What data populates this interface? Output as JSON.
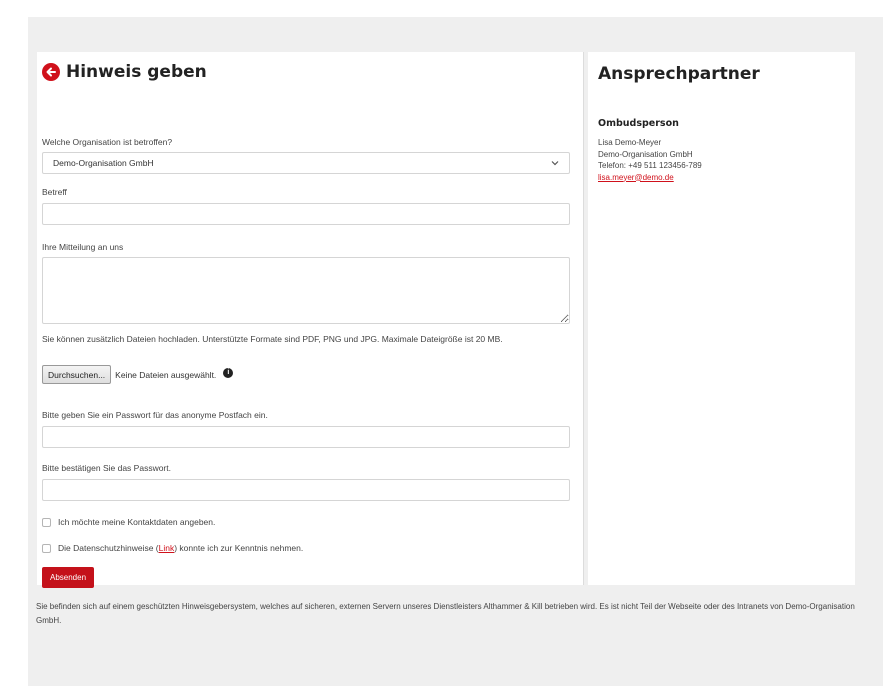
{
  "form": {
    "title": "Hinweis geben",
    "organization_label": "Welche Organisation ist betroffen?",
    "organization_value": "Demo-Organisation GmbH",
    "subject_label": "Betreff",
    "subject_value": "",
    "message_label": "Ihre Mitteilung an uns",
    "message_value": "",
    "upload_note": "Sie können zusätzlich Dateien hochladen. Unterstützte Formate sind PDF, PNG und JPG. Maximale Dateigröße ist 20 MB.",
    "browse_label": "Durchsuchen...",
    "no_files_text": "Keine Dateien ausgewählt.",
    "password_label": "Bitte geben Sie ein Passwort für das anonyme Postfach ein.",
    "password_confirm_label": "Bitte bestätigen Sie das Passwort.",
    "contact_checkbox_label": "Ich möchte meine Kontaktdaten angeben.",
    "privacy_prefix": "Die Datenschutzhinweise (",
    "privacy_link": "Link",
    "privacy_suffix": ") konnte ich zur Kenntnis nehmen.",
    "submit_label": "Absenden"
  },
  "contact": {
    "title": "Ansprechpartner",
    "role": "Ombudsperson",
    "name": "Lisa Demo-Meyer",
    "organization": "Demo-Organisation GmbH",
    "phone": "Telefon: +49 511 123456-789",
    "email": "lisa.meyer@demo.de"
  },
  "footer": {
    "text": "Sie befinden sich auf einem geschützten Hinweisgebersystem, welches auf sicheren, externen Servern unseres Dienstleisters Althammer & Kill betrieben wird. Es ist nicht Teil der Webseite oder des Intranets von Demo-Organisation GmbH."
  },
  "icons": {
    "back": "arrow-left-circle-icon",
    "info": "info-circle-icon",
    "dropdown": "chevron-down-icon"
  },
  "colors": {
    "accent": "#d0111b",
    "submit": "#c4111a",
    "background": "#efefef"
  }
}
